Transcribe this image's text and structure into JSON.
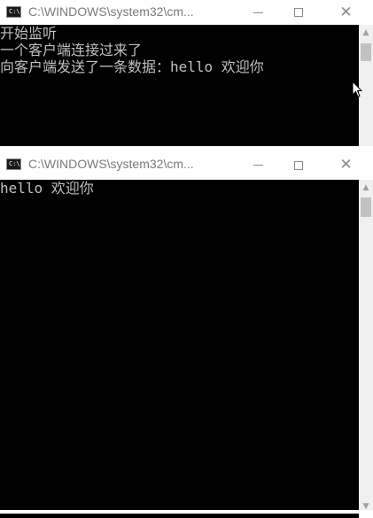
{
  "windows": [
    {
      "icon_text": "C:\\",
      "title": "C:\\WINDOWS\\system32\\cm...",
      "lines": [
        "开始监听",
        "一个客户端连接过来了",
        "向客户端发送了一条数据：hello 欢迎你"
      ]
    },
    {
      "icon_text": "C:\\",
      "title": "C:\\WINDOWS\\system32\\cm...",
      "lines": [
        "hello 欢迎你"
      ]
    }
  ],
  "controls": {
    "minimize": "",
    "maximize": "",
    "close": "✕"
  },
  "scrollbar": {
    "up_arrow": "▲",
    "down_arrow": "▼"
  },
  "colors": {
    "console_bg": "#000000",
    "console_text": "#c0c0c0",
    "titlebar_bg": "#ffffff",
    "title_text": "#7a7a7a"
  }
}
